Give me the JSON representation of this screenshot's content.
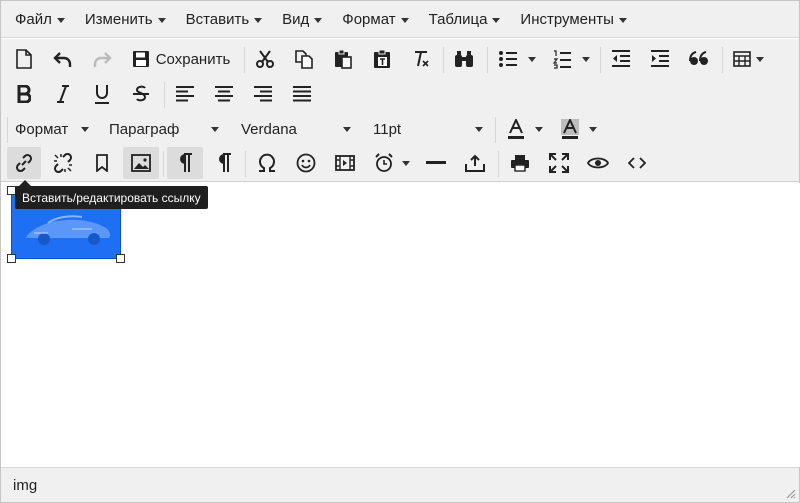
{
  "menubar": {
    "items": [
      "Файл",
      "Изменить",
      "Вставить",
      "Вид",
      "Формат",
      "Таблица",
      "Инструменты"
    ]
  },
  "toolbar": {
    "save_label": "Сохранить",
    "format_menu_label": "Формат",
    "block_format_value": "Параграф",
    "font_family_value": "Verdana",
    "font_size_value": "11pt"
  },
  "tooltip": {
    "text": "Вставить/редактировать ссылку"
  },
  "content": {
    "selected_element": "image"
  },
  "statusbar": {
    "path": "img"
  },
  "colors": {
    "toolbar_bg": "#f0f0f0",
    "image_fill": "#1f6ff5",
    "tooltip_bg": "#1f1f1f"
  }
}
